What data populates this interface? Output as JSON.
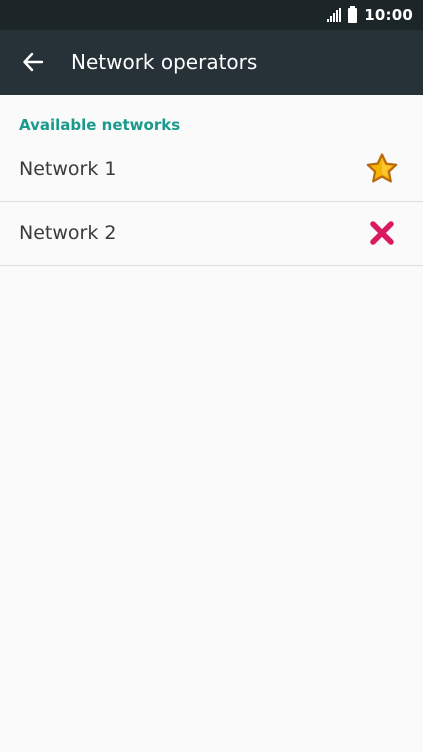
{
  "status_bar": {
    "time": "10:00",
    "signal_icon": "signal-icon",
    "battery_icon": "battery-icon"
  },
  "app_bar": {
    "back_icon": "arrow-back-icon",
    "title": "Network operators"
  },
  "section": {
    "header": "Available networks"
  },
  "networks": [
    {
      "label": "Network 1",
      "icon": "star-icon",
      "icon_color": "#f5b400"
    },
    {
      "label": "Network 2",
      "icon": "close-x-icon",
      "icon_color": "#d81b60"
    }
  ],
  "colors": {
    "status_bar": "#1c2527",
    "app_bar": "#263238",
    "accent": "#1a9a8b",
    "background": "#fafafa"
  }
}
